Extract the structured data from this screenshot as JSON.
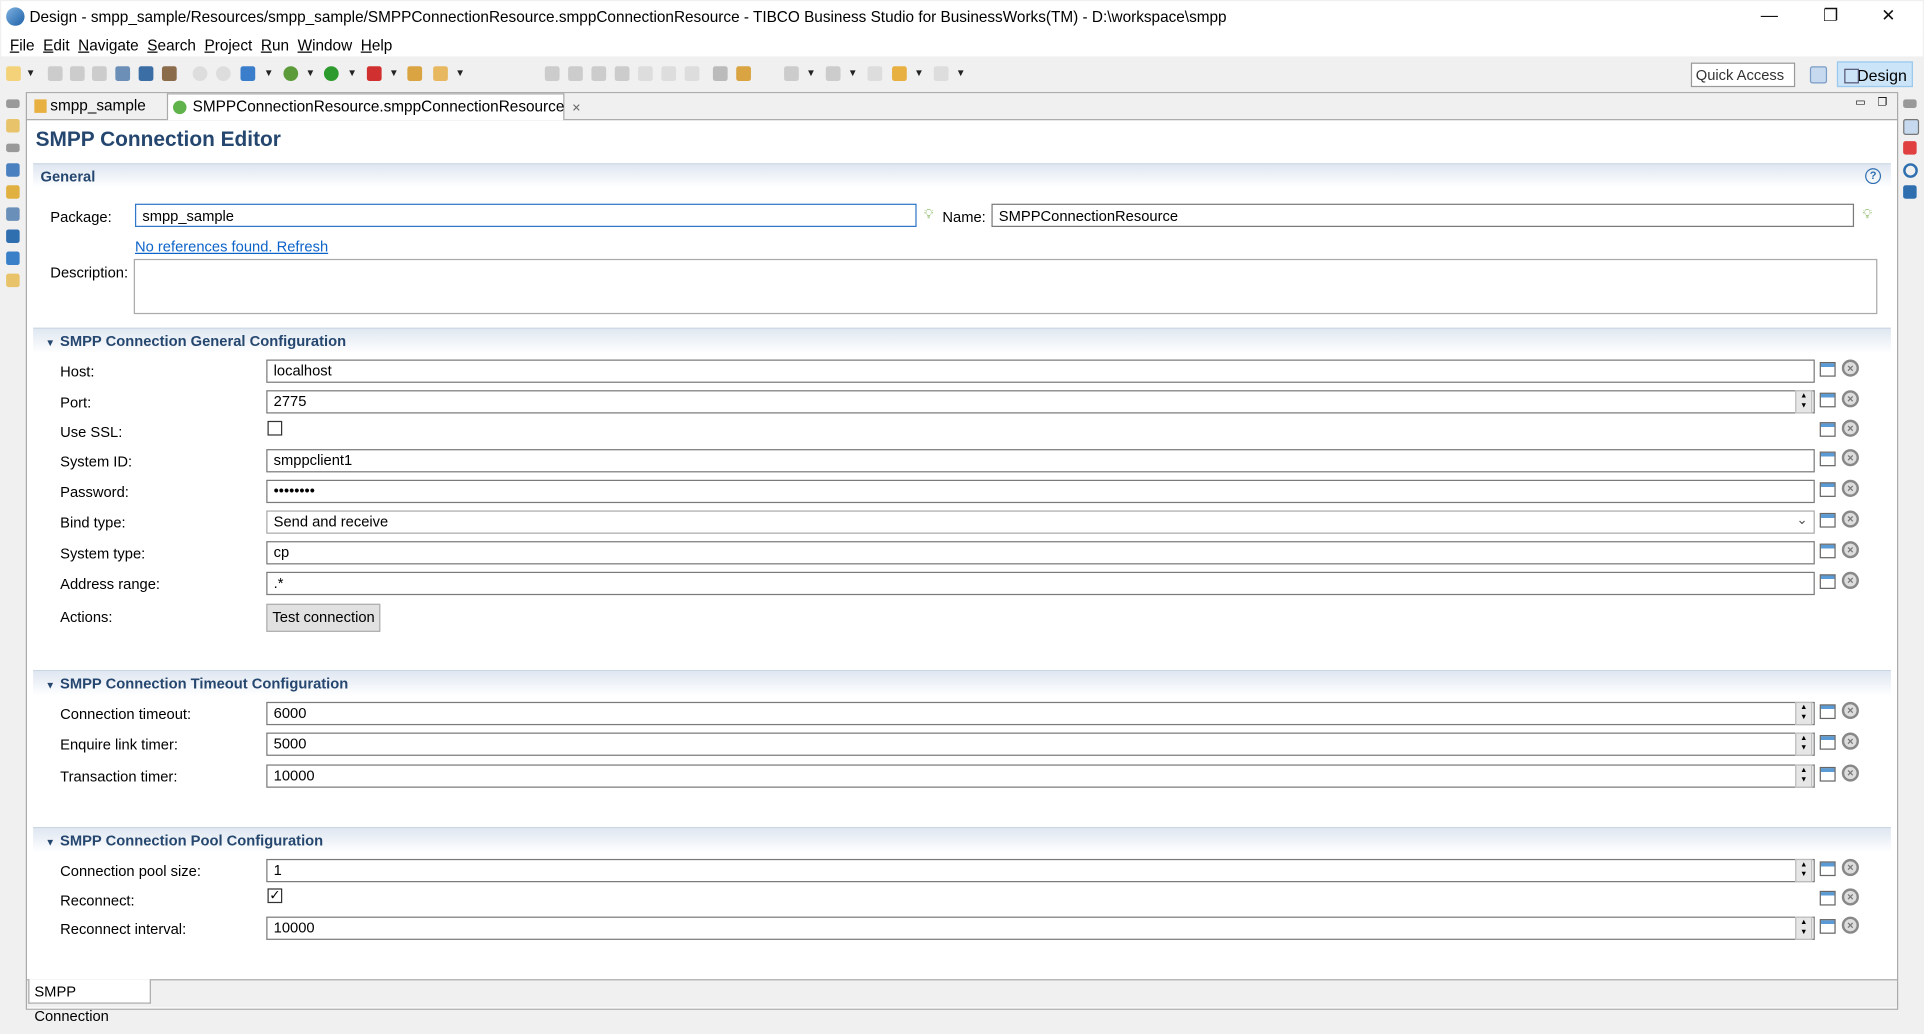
{
  "window": {
    "title": "Design - smpp_sample/Resources/smpp_sample/SMPPConnectionResource.smppConnectionResource - TIBCO Business Studio for BusinessWorks(TM) - D:\\workspace\\smpp",
    "minimize": "—",
    "restore": "❐",
    "close": "✕"
  },
  "menu": [
    "File",
    "Edit",
    "Navigate",
    "Search",
    "Project",
    "Run",
    "Window",
    "Help"
  ],
  "toolbar": {
    "quick_access": "Quick Access",
    "perspective": "Design"
  },
  "tabs": [
    {
      "label": "smpp_sample"
    },
    {
      "label": "SMPPConnectionResource.smppConnectionResource",
      "close": "✕"
    }
  ],
  "editor": {
    "title": "SMPP Connection Editor",
    "general": {
      "header": "General",
      "help": "?",
      "package_label": "Package:",
      "package_value": "smpp_sample",
      "name_label": "Name:",
      "name_value": "SMPPConnectionResource",
      "link": "No references found. Refresh",
      "description_label": "Description:",
      "description_value": ""
    },
    "general_config": {
      "header": "SMPP Connection General Configuration",
      "host_label": "Host:",
      "host": "localhost",
      "port_label": "Port:",
      "port": "2775",
      "ssl_label": "Use SSL:",
      "ssl": false,
      "system_id_label": "System ID:",
      "system_id": "smppclient1",
      "password_label": "Password:",
      "password": "••••••••",
      "bind_label": "Bind type:",
      "bind": "Send and receive",
      "system_type_label": "System type:",
      "system_type": "cp",
      "address_label": "Address range:",
      "address": ".*",
      "actions_label": "Actions:",
      "test_button": "Test connection"
    },
    "timeout_config": {
      "header": "SMPP Connection Timeout Configuration",
      "conn_timeout_label": "Connection timeout:",
      "conn_timeout": "6000",
      "enquire_label": "Enquire link timer:",
      "enquire": "5000",
      "transaction_label": "Transaction timer:",
      "transaction": "10000"
    },
    "pool_config": {
      "header": "SMPP Connection Pool Configuration",
      "pool_size_label": "Connection pool size:",
      "pool_size": "1",
      "reconnect_label": "Reconnect:",
      "reconnect": true,
      "reconnect_mark": "✓",
      "interval_label": "Reconnect interval:",
      "interval": "10000"
    },
    "bottom_tab": "SMPP Connection"
  }
}
